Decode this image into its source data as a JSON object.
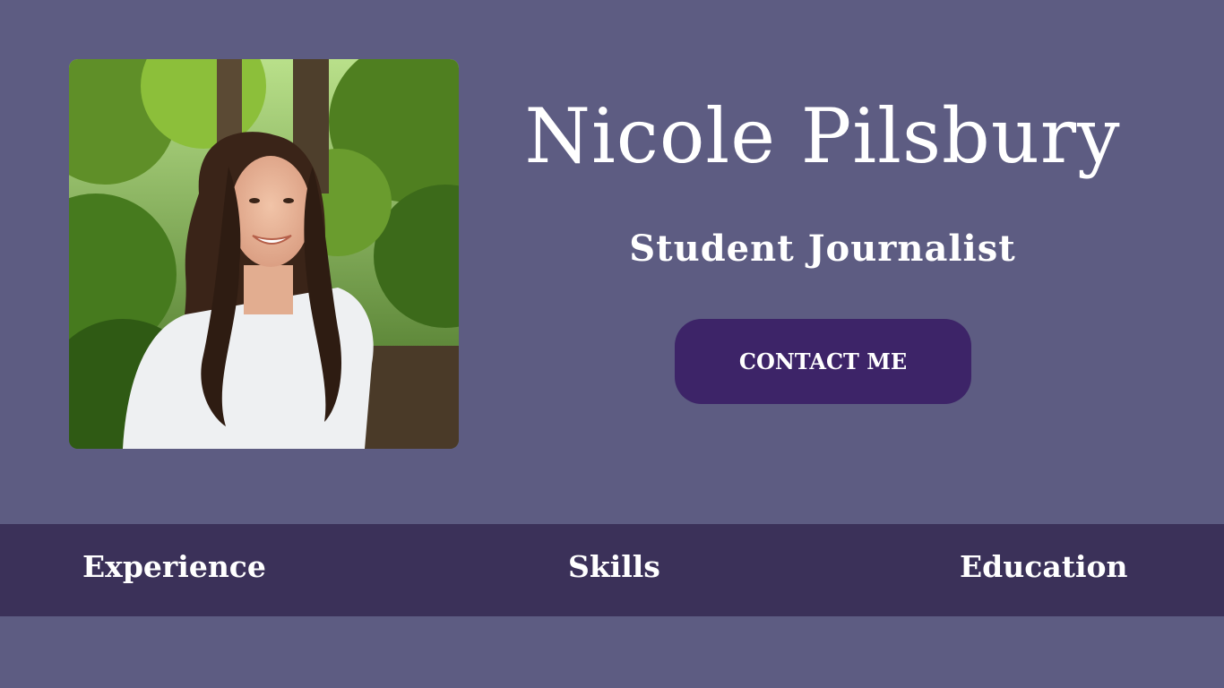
{
  "profile": {
    "name": "Nicole Pilsbury",
    "role": "Student Journalist",
    "contact_label": "CONTACT ME",
    "photo_alt": "Nicole Pilsbury"
  },
  "nav": {
    "items": [
      {
        "label": "Experience"
      },
      {
        "label": "Skills"
      },
      {
        "label": "Education"
      }
    ]
  },
  "colors": {
    "page_background": "#5d5c82",
    "nav_background": "#3b3159",
    "button_background": "#3d2468",
    "text": "#ffffff"
  }
}
